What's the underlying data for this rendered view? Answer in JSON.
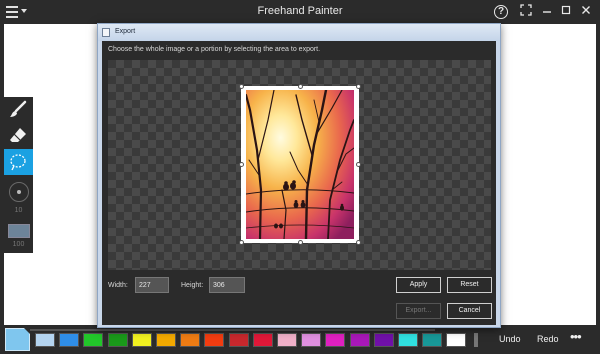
{
  "app": {
    "title": "Freehand Painter",
    "window_buttons": {
      "help": "?",
      "fullscreen": "⤧",
      "minimize": "–",
      "maximize": "☐",
      "close": "✕"
    }
  },
  "tools": {
    "size_value": "10",
    "opacity_value": "100",
    "current_color": "#6d8499",
    "accent": "#1ba1e2"
  },
  "dialog": {
    "title": "Export",
    "instruction": "Choose the whole image or a portion by selecting the area to export.",
    "width_label": "Width:",
    "width_value": "227",
    "height_label": "Height:",
    "height_value": "306",
    "apply_label": "Apply",
    "reset_label": "Reset",
    "export_label": "Export...",
    "cancel_label": "Cancel"
  },
  "bottombar": {
    "selected_color": "#7fc6ee",
    "swatches": [
      "#b4d4f0",
      "#2f8ee8",
      "#22c62a",
      "#1a9a1a",
      "#f0f020",
      "#f2a900",
      "#ee7c14",
      "#f23c10",
      "#c8282d",
      "#e01838",
      "#f0b0c8",
      "#e090e0",
      "#e020c0",
      "#a818b8",
      "#7010a8",
      "#30e0e0",
      "#189898",
      "#ffffff"
    ],
    "undo_label": "Undo",
    "redo_label": "Redo",
    "more_label": "•••"
  }
}
